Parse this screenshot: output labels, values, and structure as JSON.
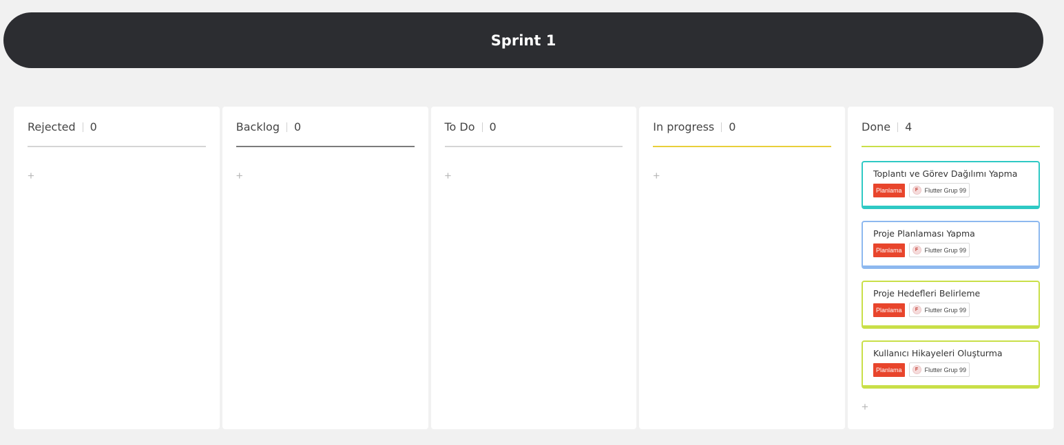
{
  "sprint": {
    "title": "Sprint 1"
  },
  "columns": [
    {
      "name": "Rejected",
      "count": "0"
    },
    {
      "name": "Backlog",
      "count": "0"
    },
    {
      "name": "To Do",
      "count": "0"
    },
    {
      "name": "In progress",
      "count": "0"
    },
    {
      "name": "Done",
      "count": "4"
    }
  ],
  "add_icon": "+",
  "cards": [
    {
      "title": "Toplantı ve Görev Dağılımı Yapma",
      "label": "Planlama",
      "team_initial": "F",
      "team": "Flutter Grup 99",
      "color": "#2ec9c4"
    },
    {
      "title": "Proje Planlaması Yapma",
      "label": "Planlama",
      "team_initial": "F",
      "team": "Flutter Grup 99",
      "color": "#8db8ef"
    },
    {
      "title": "Proje Hedefleri Belirleme",
      "label": "Planlama",
      "team_initial": "F",
      "team": "Flutter Grup 99",
      "color": "#c9df48"
    },
    {
      "title": "Kullanıcı Hikayeleri Oluşturma",
      "label": "Planlama",
      "team_initial": "F",
      "team": "Flutter Grup 99",
      "color": "#c9df48"
    }
  ],
  "colors": {
    "header_bg": "#2c2d31",
    "label_bg": "#e8452c",
    "page_bg": "#f1f1f1",
    "inprogress_line": "#e8cf3a",
    "done_line": "#c9df48"
  }
}
